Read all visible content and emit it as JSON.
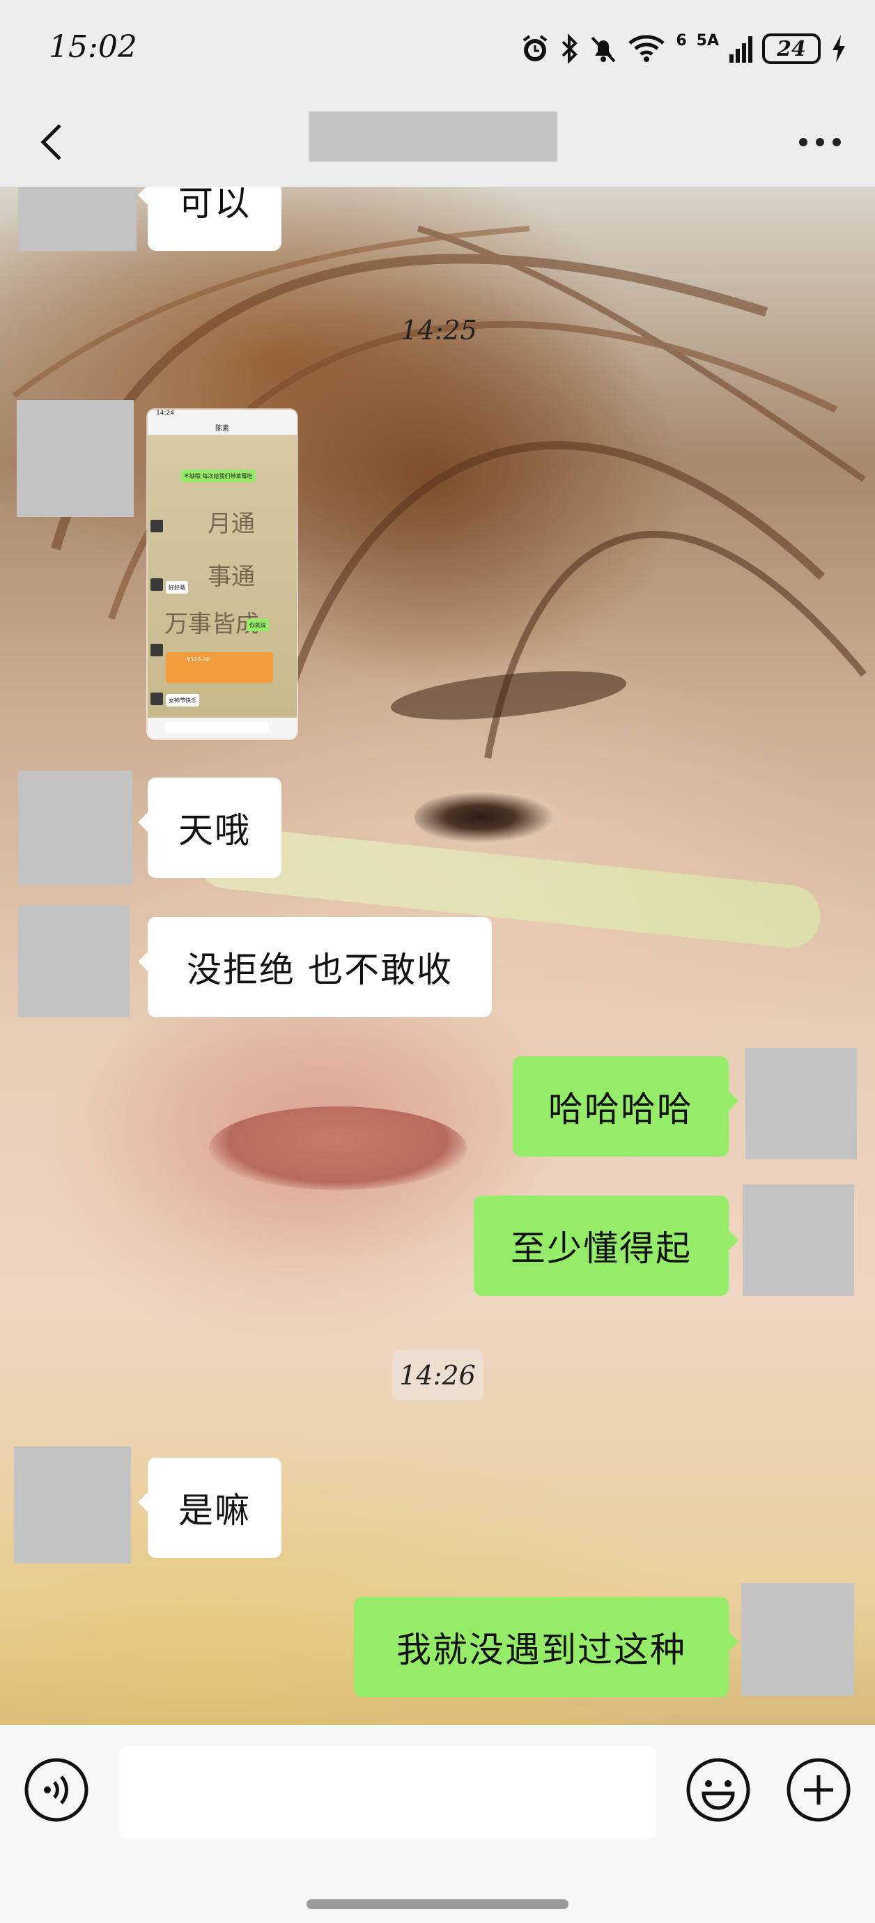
{
  "status_bar": {
    "time": "15:02",
    "network_label": "5A",
    "signal_sup": "6",
    "battery": "24"
  },
  "nav": {
    "back_icon": "chevron-left-icon",
    "more_icon": "more-dots-icon"
  },
  "messages": [
    {
      "direction": "in",
      "type": "text",
      "text": "可以"
    },
    {
      "type": "timestamp",
      "text": "14:25"
    },
    {
      "direction": "in",
      "type": "image",
      "thumb": {
        "time": "14:24",
        "title": "陈素",
        "green_msg": "不缺哦 每次给我们带草莓吃",
        "white_msg": "好好哦",
        "callig_lines": [
          "月通",
          "事通",
          "万事皆成"
        ],
        "green_msg2": "你就说",
        "transfer": "¥520.00",
        "last_msg": "女神节快乐"
      }
    },
    {
      "direction": "in",
      "type": "text",
      "text": "天哦"
    },
    {
      "direction": "in",
      "type": "text",
      "text": "没拒绝 也不敢收"
    },
    {
      "direction": "out",
      "type": "text",
      "text": "哈哈哈哈"
    },
    {
      "direction": "out",
      "type": "text",
      "text": "至少懂得起"
    },
    {
      "type": "timestamp",
      "text": "14:26"
    },
    {
      "direction": "in",
      "type": "text",
      "text": "是嘛"
    },
    {
      "direction": "out",
      "type": "text",
      "text": "我就没遇到过这种"
    }
  ],
  "input_bar": {
    "voice_icon": "voice-icon",
    "text_value": "",
    "emoji_icon": "emoji-icon",
    "plus_icon": "plus-circle-icon"
  },
  "colors": {
    "outgoing_bubble": "#95ec69",
    "incoming_bubble": "#ffffff",
    "avatar_placeholder": "#c3c3c3",
    "bar_background": "#ededed"
  }
}
